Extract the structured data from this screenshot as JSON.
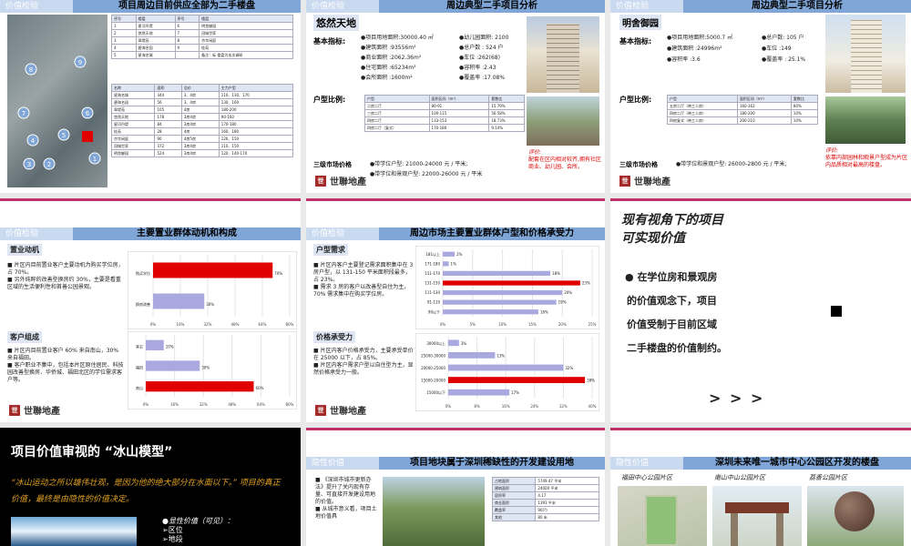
{
  "slide1": {
    "tag": "价值检验",
    "title": "项目周边目前供应全部为二手楼盘",
    "map_labels": [
      "8",
      "9",
      "7",
      "6",
      "4",
      "5",
      "3",
      "2",
      "1"
    ],
    "table1_headers": [
      "序号",
      "楼盘",
      "序号",
      "楼盘"
    ],
    "table1_rows": [
      [
        "1",
        "星河丹堤",
        "6",
        "明舍御园"
      ],
      [
        "2",
        "悠然天地",
        "7",
        "冠城世家"
      ],
      [
        "3",
        "翠堤苑",
        "8",
        "京华闲庭"
      ],
      [
        "4",
        "碧海名园",
        "9",
        "桂苑"
      ],
      [
        "5",
        "星海名城",
        "",
        "备注：标 楼盘为本次调研"
      ]
    ],
    "table2_headers": [
      "名称",
      "面积",
      "总价",
      "主力户型"
    ],
    "table2_rows": [
      [
        "星海名城",
        "344",
        "3、4房",
        "110、130、170"
      ],
      [
        "碧海名园",
        "56",
        "3、4房",
        "130、160"
      ],
      [
        "翠堤苑",
        "105",
        "4房",
        "180-200"
      ],
      [
        "悠然天地",
        "178",
        "3房4房",
        "90-160"
      ],
      [
        "星河丹堤",
        "84",
        "3房4房",
        "170-180"
      ],
      [
        "桂苑",
        "28",
        "4房",
        "160、180"
      ],
      [
        "京华闲庭",
        "90",
        "4房5房",
        "126、150"
      ],
      [
        "冠城世家",
        "372",
        "3房4房",
        "110、150"
      ],
      [
        "明舍御园",
        "524",
        "3房4房",
        "120、140-170"
      ]
    ]
  },
  "slide2": {
    "tag": "价值检验",
    "title": "周边典型二手项目分析",
    "project": "悠然天地",
    "basic_label": "基本指标:",
    "left_items": [
      "项目用地面积:30000.40 ㎡",
      "建筑面积 :93556m²",
      "商业面积 :2062.36m²",
      "住宅面积 :65234m²",
      "会所面积 :1600m²"
    ],
    "right_items": [
      "幼儿园面积: 2100",
      "总户数 :  524 户",
      "车位 :262(68)",
      "容积率 :2.43",
      "覆盖率 :17.08%"
    ],
    "ratio_label": "户型比例:",
    "ratio_headers": [
      "户型",
      "面积区间（m²）",
      "套数比"
    ],
    "ratio_rows": [
      [
        "二房二厅",
        "80-91",
        "15.79%"
      ],
      [
        "三房二厅",
        "100-115",
        "56.58%"
      ],
      [
        "四房二厅",
        "133-153",
        "18.73%"
      ],
      [
        "四房二厅（复式）",
        "170-180",
        "9.14%"
      ]
    ],
    "review_label": "评价:",
    "review": "配套在区内相对较齐,拥有社区商业、幼儿园、会所。",
    "price_label": "三级市场价格",
    "price_items": [
      "带学位户型:  21000-24000 元 / 平米;",
      "带学位和景观户型:  22000-26000 元 / 平米"
    ],
    "logo": "世聯地產"
  },
  "slide3": {
    "tag": "价值检验",
    "title": "周边典型二手项目分析",
    "project": "明舍御园",
    "basic_label": "基本指标:",
    "left_items": [
      "项目用地面积:5000.7 ㎡",
      "建筑面积 :24996m²",
      "容积率 :3.6"
    ],
    "right_items": [
      "总户数:  105 户",
      "车位 :149",
      "覆盖率 : 25.1%"
    ],
    "ratio_label": "户型比例:",
    "ratio_headers": [
      "户型",
      "面积区间（m²）",
      "套数比"
    ],
    "ratio_rows": [
      [
        "五房二厅（带工人房）",
        "160-162",
        "80%"
      ],
      [
        "四房二厅（带工人房）",
        "180-200",
        "10%"
      ],
      [
        "四房复式（带工人房）",
        "200-210",
        "10%"
      ]
    ],
    "review_label": "评价:",
    "review": "依靠内部园林和观景户型成为片区内品质相对最高的楼盘。",
    "price_label": "三级市场价格",
    "price_items": [
      "带学位和景观户型:  26000-2800 元 / 平米;"
    ],
    "logo": "世聯地產"
  },
  "slide4": {
    "tag": "价值检验",
    "title": "主要置业群体动机和构成",
    "sec1": "置业动机",
    "sec1_text": [
      "片区内目前置业客户主要动机为购买学位房，占 70%。",
      "另外纯粹的改善型换房约 30%，主要是看重区域的生活便利性和首善公园景观。"
    ],
    "sec2": "客户组成",
    "sec2_text": [
      "片区内目前置业客户 60% 来自南山，30% 来自福田。",
      "客户职业不集中，包括本片区原住居民、科技园改善型换房、华侨城、福田北区的学位需求客户等。"
    ],
    "logo": "世聯地產"
  },
  "slide5": {
    "tag": "价值检验",
    "title": "周边市场主要置业群体户型和价格承受力",
    "sec1": "户型需求",
    "sec1_text": [
      "片区内客户主要登记需求面积集中在 3 房户型，以 131-150 平米面积段最多，占 23%。",
      "需求 3 房的客户以改善型自住为主，70% 需求集中在购买学位房。"
    ],
    "sec2": "价格承受力",
    "sec2_text": [
      "片区内客户价格承受力，主要承受单价在 25000 以下，占 85%。",
      "片区内客户需求户型以自住型为主，显然价格承受力一般。"
    ],
    "logo": "世聯地產"
  },
  "slide6": {
    "heading": [
      "现有视角下的项目",
      "可实现价值"
    ],
    "body": [
      "在学位房和景观房",
      "的价值观念下，项目",
      "价值受制于目前区域",
      "二手楼盘的价值制约。"
    ],
    "arrows": "> > >"
  },
  "slide7": {
    "title": "项目价值审视的 “冰山模型”",
    "quote": "“冰山运动之所以雄伟壮观，是因为他的绝大部分在水面以下。” 项目的真正价值，最终是由隐性的价值决定。",
    "items": [
      "显性价值（可见）：",
      "区位",
      "地段"
    ]
  },
  "slide8": {
    "tag": "隐性价值",
    "title": "项目地块属于深圳稀缺性的开发建设用地",
    "text": [
      "《深圳市城市更新办法》提升了关内现有存量、可直接开发建设用地的价值。",
      "从城市意义看，项目土地价值具"
    ],
    "table_rows": [
      [
        "占地面积",
        "5749.47 平米"
      ],
      [
        "建筑面积",
        "24000 平米"
      ],
      [
        "容积率",
        "4.17"
      ],
      [
        "商业面积",
        "1393 平米"
      ],
      [
        "覆盖率",
        "90(?)"
      ],
      [
        "其他",
        "80 米"
      ]
    ]
  },
  "slide9": {
    "tag": "隐性价值",
    "title": "深圳未来唯一城市中心公园区开发的楼盘",
    "labels": [
      "福田中心公园片区",
      "南山中山公园片区",
      "荔香公园片区"
    ]
  },
  "chart_data": [
    {
      "type": "bar",
      "title": "",
      "categories": [
        "购买学位",
        "换房改善"
      ],
      "values": [
        70,
        30
      ],
      "xlim": [
        0,
        80
      ]
    },
    {
      "type": "bar",
      "title": "",
      "categories": [
        "其它",
        "福田",
        "南山"
      ],
      "values": [
        10,
        30,
        60
      ],
      "xlim": [
        0,
        80
      ]
    },
    {
      "type": "bar",
      "title": "",
      "categories": [
        "181以上",
        "171-180",
        "151-170",
        "131-150",
        "111-130",
        "91-110",
        "90以下"
      ],
      "values": [
        2,
        1,
        18,
        23,
        20,
        19,
        16
      ],
      "xlim": [
        0,
        25
      ]
    },
    {
      "type": "bar",
      "title": "",
      "categories": [
        "30000以上",
        "25000-30000",
        "20000-25000",
        "15000-20000",
        "15000以下"
      ],
      "values": [
        3,
        13,
        32,
        38,
        17
      ],
      "xlim": [
        0,
        40
      ]
    }
  ],
  "colors": {
    "header_bar": "#7fa6d6",
    "header_tag": "#c9d9ef",
    "accent_red": "#e00000",
    "bar_blue": "#a9a9e0",
    "logo": "#a52a2a"
  }
}
